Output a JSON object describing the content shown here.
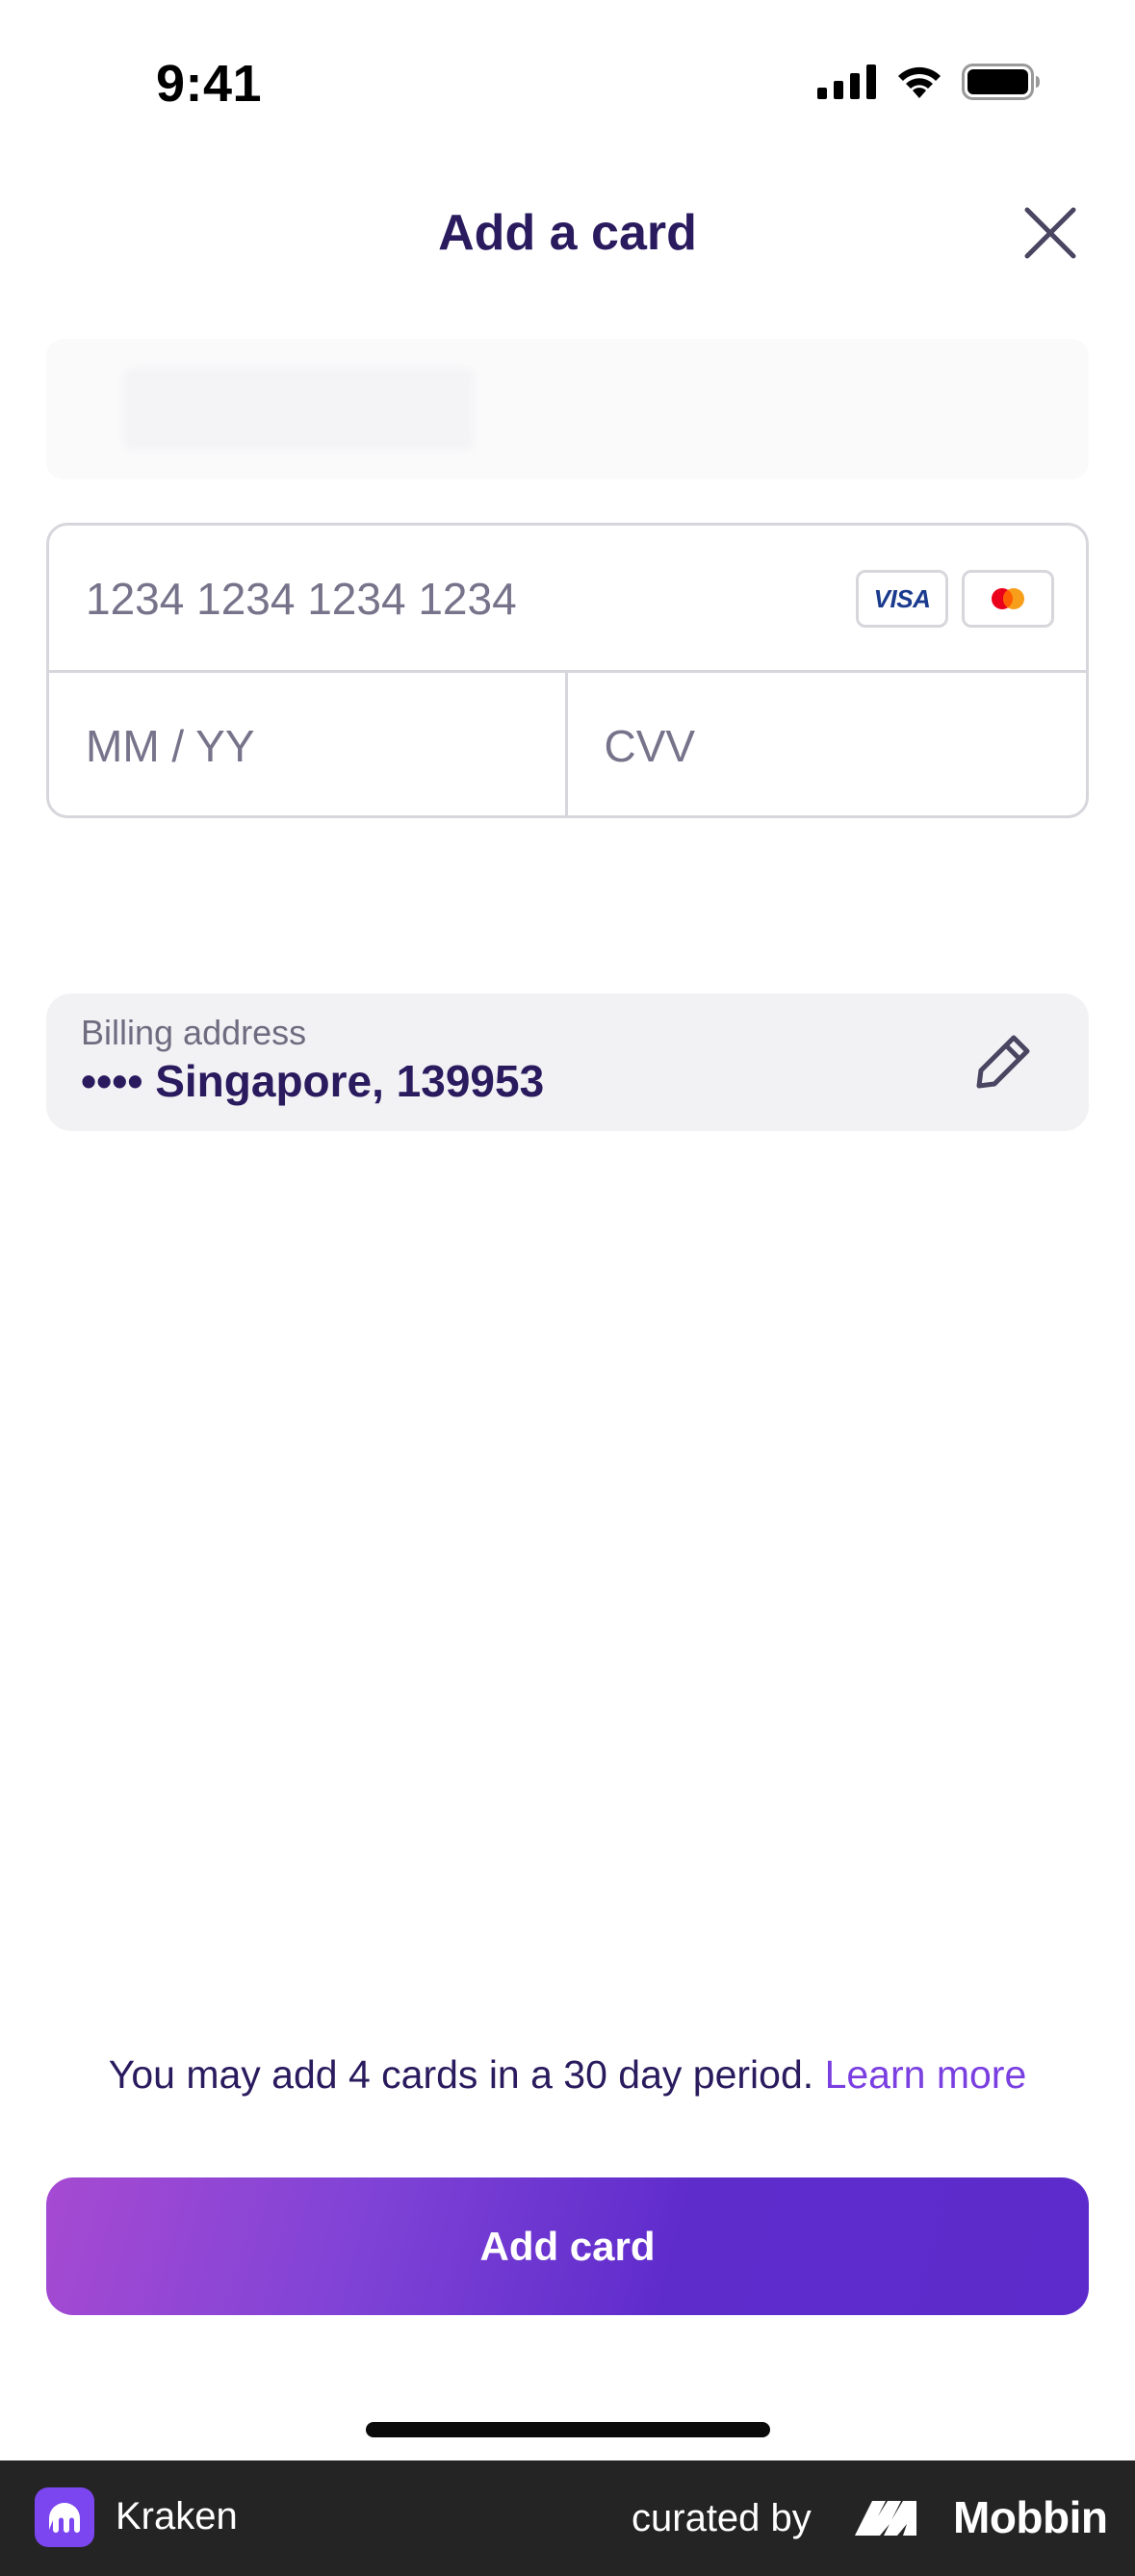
{
  "status_bar": {
    "time": "9:41",
    "icons": [
      "cellular-signal-icon",
      "wifi-icon",
      "battery-icon"
    ]
  },
  "header": {
    "title": "Add a card",
    "close_icon": "close-icon"
  },
  "card_form": {
    "card_number_placeholder": "1234 1234 1234 1234",
    "card_number_value": "",
    "brands": {
      "visa_label": "VISA",
      "mastercard_icon": "mastercard-icon"
    },
    "expiry_placeholder": "MM / YY",
    "expiry_value": "",
    "cvv_placeholder": "CVV",
    "cvv_value": ""
  },
  "billing": {
    "label": "Billing address",
    "value": "•••• Singapore, 139953",
    "edit_icon": "pencil-icon"
  },
  "limit_note": {
    "text": "You may add 4 cards in a 30 day period.",
    "link": "Learn more"
  },
  "primary_action": {
    "label": "Add card"
  },
  "footer": {
    "app_name": "Kraken",
    "curated_by": "curated by",
    "brand": "Mobbin"
  },
  "colors": {
    "title": "#2a1a5e",
    "link": "#7a3fe0",
    "button_gradient_start": "#a64ad2",
    "button_gradient_end": "#5d2bcb",
    "footer_bg": "#242424",
    "kraken_purple": "#7b45f0"
  }
}
